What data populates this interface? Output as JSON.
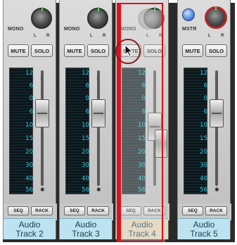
{
  "strips": [
    {
      "mono": "MONO",
      "l": "L",
      "r": "R",
      "mute": "MUTE",
      "solo": "SOLO",
      "seq": "SEQ",
      "rack": "RACK",
      "name_line1": "Audio",
      "name_line2": "Track 2"
    },
    {
      "mono": "MONO",
      "l": "L",
      "r": "R",
      "mute": "MUTE",
      "solo": "SOLO",
      "seq": "SEQ",
      "rack": "RACK",
      "name_line1": "Audio",
      "name_line2": "Track 3"
    },
    {
      "mono": "MONO",
      "l": "L",
      "r": "R",
      "mute": "MUTE",
      "solo": "SOLO",
      "seq": "SEQ",
      "rack": "RACK",
      "name_line1": "Audio",
      "name_line2": "Track 4"
    },
    {
      "mono": "MSTR",
      "l": "L",
      "r": "R",
      "mute": "MUTE",
      "solo": "SOLO",
      "seq": "SEQ",
      "rack": "RACK",
      "name_line1": "Audio",
      "name_line2": "Track 5"
    }
  ],
  "meter_scale": [
    "12",
    "6",
    "0",
    "6",
    "10",
    "15",
    "20",
    "30",
    "40",
    "56"
  ],
  "colors": {
    "accent_red": "#e0101a",
    "label_bg": "#bde3f1",
    "meter_text": "#38c4dc"
  }
}
